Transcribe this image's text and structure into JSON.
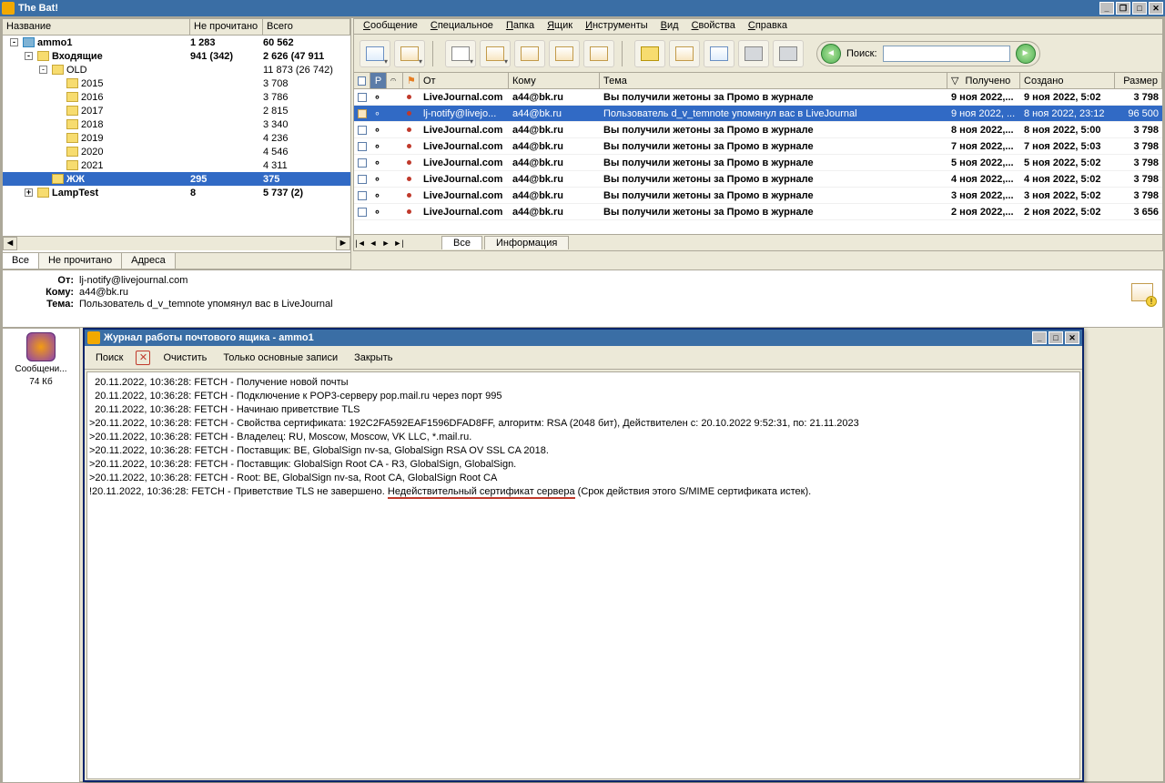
{
  "app": {
    "title": "The Bat!"
  },
  "winbuttons": {
    "min": "_",
    "restore": "❐",
    "max": "□",
    "close": "✕"
  },
  "folder_panel": {
    "headers": {
      "name": "Название",
      "unread": "Не прочитано",
      "total": "Всего"
    },
    "rows": [
      {
        "indent": 0,
        "exp": "-",
        "icon": "mbx",
        "name": "ammo1",
        "unread": "1 283",
        "total": "60 562",
        "bold": true
      },
      {
        "indent": 1,
        "exp": "-",
        "icon": "fld",
        "name": "Входящие",
        "unread": "941 (342)",
        "total": "2 626 (47 911",
        "bold": true
      },
      {
        "indent": 2,
        "exp": "-",
        "icon": "fld",
        "name": "OLD",
        "unread": "",
        "total": "11 873 (26 742)"
      },
      {
        "indent": 3,
        "exp": "",
        "icon": "fld",
        "name": "2015",
        "unread": "",
        "total": "3 708"
      },
      {
        "indent": 3,
        "exp": "",
        "icon": "fld",
        "name": "2016",
        "unread": "",
        "total": "3 786"
      },
      {
        "indent": 3,
        "exp": "",
        "icon": "fld",
        "name": "2017",
        "unread": "",
        "total": "2 815"
      },
      {
        "indent": 3,
        "exp": "",
        "icon": "fld",
        "name": "2018",
        "unread": "",
        "total": "3 340"
      },
      {
        "indent": 3,
        "exp": "",
        "icon": "fld",
        "name": "2019",
        "unread": "",
        "total": "4 236"
      },
      {
        "indent": 3,
        "exp": "",
        "icon": "fld",
        "name": "2020",
        "unread": "",
        "total": "4 546"
      },
      {
        "indent": 3,
        "exp": "",
        "icon": "fld",
        "name": "2021",
        "unread": "",
        "total": "4 311"
      },
      {
        "indent": 2,
        "exp": "",
        "icon": "fld",
        "name": "ЖЖ",
        "unread": "295",
        "total": "375",
        "bold": true,
        "sel": true
      },
      {
        "indent": 1,
        "exp": "+",
        "icon": "fld",
        "name": "LampTest",
        "unread": "8",
        "total": "5 737 (2)",
        "bold": true
      }
    ]
  },
  "left_tabs": {
    "all": "Все",
    "unread": "Не прочитано",
    "addresses": "Адреса"
  },
  "menu": {
    "items": [
      "Сообщение",
      "Специальное",
      "Папка",
      "Ящик",
      "Инструменты",
      "Вид",
      "Свойства",
      "Справка"
    ]
  },
  "toolbar": {
    "buttons": [
      "new-mail",
      "reply",
      "compose",
      "send-receive",
      "check-mail",
      "forward",
      "get-mail",
      "addressbook",
      "filter",
      "flag",
      "print",
      "delete"
    ],
    "search_label": "Поиск:"
  },
  "list": {
    "headers": {
      "from": "От",
      "to": "Кому",
      "subject": "Тема",
      "received": "Получено",
      "created": "Создано",
      "size": "Размер"
    },
    "sort_indicator": "▽",
    "rows": [
      {
        "read": false,
        "from": "LiveJournal.com",
        "to": "a44@bk.ru",
        "subj": "Вы получили жетоны за Промо в журнале",
        "recv": "9 ноя 2022,...",
        "crt": "9 ноя 2022, 5:02",
        "size": "3 798"
      },
      {
        "read": true,
        "sel": true,
        "from": "lj-notify@livejo...",
        "to": "a44@bk.ru",
        "subj": "Пользователь d_v_temnote упомянул вас в LiveJournal",
        "recv": "9 ноя 2022, ...",
        "crt": "8 ноя 2022, 23:12",
        "size": "96 500"
      },
      {
        "read": false,
        "from": "LiveJournal.com",
        "to": "a44@bk.ru",
        "subj": "Вы получили жетоны за Промо в журнале",
        "recv": "8 ноя 2022,...",
        "crt": "8 ноя 2022, 5:00",
        "size": "3 798"
      },
      {
        "read": false,
        "from": "LiveJournal.com",
        "to": "a44@bk.ru",
        "subj": "Вы получили жетоны за Промо в журнале",
        "recv": "7 ноя 2022,...",
        "crt": "7 ноя 2022, 5:03",
        "size": "3 798"
      },
      {
        "read": false,
        "from": "LiveJournal.com",
        "to": "a44@bk.ru",
        "subj": "Вы получили жетоны за Промо в журнале",
        "recv": "5 ноя 2022,...",
        "crt": "5 ноя 2022, 5:02",
        "size": "3 798"
      },
      {
        "read": false,
        "from": "LiveJournal.com",
        "to": "a44@bk.ru",
        "subj": "Вы получили жетоны за Промо в журнале",
        "recv": "4 ноя 2022,...",
        "crt": "4 ноя 2022, 5:02",
        "size": "3 798"
      },
      {
        "read": false,
        "from": "LiveJournal.com",
        "to": "a44@bk.ru",
        "subj": "Вы получили жетоны за Промо в журнале",
        "recv": "3 ноя 2022,...",
        "crt": "3 ноя 2022, 5:02",
        "size": "3 798"
      },
      {
        "read": false,
        "from": "LiveJournal.com",
        "to": "a44@bk.ru",
        "subj": "Вы получили жетоны за Промо в журнале",
        "recv": "2 ноя 2022,...",
        "crt": "2 ноя 2022, 5:02",
        "size": "3 656"
      }
    ],
    "tabs": {
      "all": "Все",
      "info": "Информация"
    },
    "nav": {
      "first": "|◄",
      "prev": "◄",
      "next": "►",
      "last": "►|"
    }
  },
  "preview": {
    "labels": {
      "from": "От:",
      "to": "Кому:",
      "subject": "Тема:"
    },
    "from": "lj-notify@livejournal.com",
    "to": "a44@bk.ru",
    "subject": "Пользователь d_v_temnote упомянул вас в LiveJournal"
  },
  "attachment": {
    "label": "Сообщени...",
    "size": "74 Кб"
  },
  "log": {
    "title": "Журнал работы почтового ящика - ammo1",
    "toolbar": {
      "search": "Поиск",
      "clear": "Очистить",
      "main_only": "Только основные записи",
      "close": "Закрыть"
    },
    "lines": [
      "  20.11.2022, 10:36:28: FETCH - Получение новой почты",
      "  20.11.2022, 10:36:28: FETCH - Подключение к POP3-серверу pop.mail.ru через порт 995",
      "  20.11.2022, 10:36:28: FETCH - Начинаю приветствие TLS",
      ">20.11.2022, 10:36:28: FETCH - Свойства сертификата: 192C2FA592EAF1596DFAD8FF, алгоритм: RSA (2048 бит), Действителен с: 20.10.2022 9:52:31, по: 21.11.2023",
      ">20.11.2022, 10:36:28: FETCH - Владелец: RU, Moscow, Moscow, VK LLC, *.mail.ru.",
      ">20.11.2022, 10:36:28: FETCH - Поставщик: BE, GlobalSign nv-sa, GlobalSign RSA OV SSL CA 2018.",
      ">20.11.2022, 10:36:28: FETCH - Поставщик: GlobalSign Root CA - R3, GlobalSign, GlobalSign.",
      ">20.11.2022, 10:36:28: FETCH - Root: BE, GlobalSign nv-sa, Root CA, GlobalSign Root CA"
    ],
    "last_line_pre": "!20.11.2022, 10:36:28: FETCH - Приветствие TLS не завершено. ",
    "last_line_uline": "Недействительный сертификат сервера",
    "last_line_post": " (Срок действия этого S/MIME сертификата истек)."
  }
}
